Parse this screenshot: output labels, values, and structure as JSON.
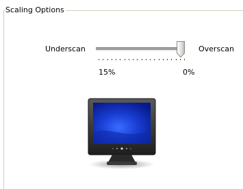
{
  "group": {
    "title": "Scaling Options"
  },
  "slider": {
    "left_label": "Underscan",
    "right_label": "Overscan",
    "min_label": "15%",
    "max_label": "0%",
    "value_fraction": 0.98,
    "tick_count": 21
  },
  "colors": {
    "frame": "#d0d0bf",
    "screen": "#1230b8"
  },
  "icons": {
    "preview": "monitor-icon",
    "thumb": "slider-thumb"
  }
}
